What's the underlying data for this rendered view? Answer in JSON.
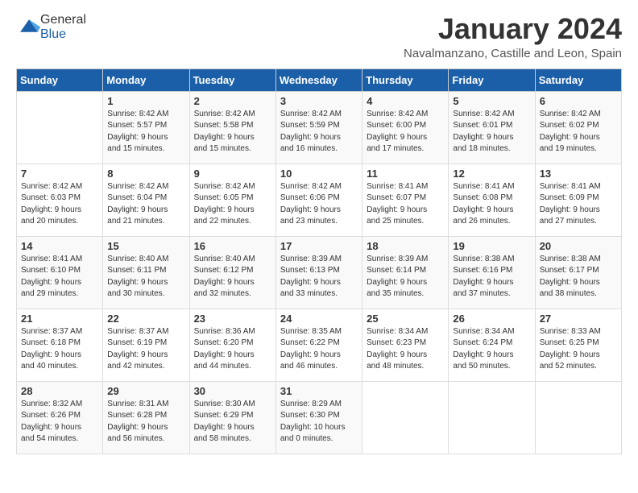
{
  "logo": {
    "general": "General",
    "blue": "Blue"
  },
  "header": {
    "month_year": "January 2024",
    "location": "Navalmanzano, Castille and Leon, Spain"
  },
  "weekdays": [
    "Sunday",
    "Monday",
    "Tuesday",
    "Wednesday",
    "Thursday",
    "Friday",
    "Saturday"
  ],
  "weeks": [
    [
      {
        "day": "",
        "content": ""
      },
      {
        "day": "1",
        "content": "Sunrise: 8:42 AM\nSunset: 5:57 PM\nDaylight: 9 hours\nand 15 minutes."
      },
      {
        "day": "2",
        "content": "Sunrise: 8:42 AM\nSunset: 5:58 PM\nDaylight: 9 hours\nand 15 minutes."
      },
      {
        "day": "3",
        "content": "Sunrise: 8:42 AM\nSunset: 5:59 PM\nDaylight: 9 hours\nand 16 minutes."
      },
      {
        "day": "4",
        "content": "Sunrise: 8:42 AM\nSunset: 6:00 PM\nDaylight: 9 hours\nand 17 minutes."
      },
      {
        "day": "5",
        "content": "Sunrise: 8:42 AM\nSunset: 6:01 PM\nDaylight: 9 hours\nand 18 minutes."
      },
      {
        "day": "6",
        "content": "Sunrise: 8:42 AM\nSunset: 6:02 PM\nDaylight: 9 hours\nand 19 minutes."
      }
    ],
    [
      {
        "day": "7",
        "content": "Sunrise: 8:42 AM\nSunset: 6:03 PM\nDaylight: 9 hours\nand 20 minutes."
      },
      {
        "day": "8",
        "content": "Sunrise: 8:42 AM\nSunset: 6:04 PM\nDaylight: 9 hours\nand 21 minutes."
      },
      {
        "day": "9",
        "content": "Sunrise: 8:42 AM\nSunset: 6:05 PM\nDaylight: 9 hours\nand 22 minutes."
      },
      {
        "day": "10",
        "content": "Sunrise: 8:42 AM\nSunset: 6:06 PM\nDaylight: 9 hours\nand 23 minutes."
      },
      {
        "day": "11",
        "content": "Sunrise: 8:41 AM\nSunset: 6:07 PM\nDaylight: 9 hours\nand 25 minutes."
      },
      {
        "day": "12",
        "content": "Sunrise: 8:41 AM\nSunset: 6:08 PM\nDaylight: 9 hours\nand 26 minutes."
      },
      {
        "day": "13",
        "content": "Sunrise: 8:41 AM\nSunset: 6:09 PM\nDaylight: 9 hours\nand 27 minutes."
      }
    ],
    [
      {
        "day": "14",
        "content": "Sunrise: 8:41 AM\nSunset: 6:10 PM\nDaylight: 9 hours\nand 29 minutes."
      },
      {
        "day": "15",
        "content": "Sunrise: 8:40 AM\nSunset: 6:11 PM\nDaylight: 9 hours\nand 30 minutes."
      },
      {
        "day": "16",
        "content": "Sunrise: 8:40 AM\nSunset: 6:12 PM\nDaylight: 9 hours\nand 32 minutes."
      },
      {
        "day": "17",
        "content": "Sunrise: 8:39 AM\nSunset: 6:13 PM\nDaylight: 9 hours\nand 33 minutes."
      },
      {
        "day": "18",
        "content": "Sunrise: 8:39 AM\nSunset: 6:14 PM\nDaylight: 9 hours\nand 35 minutes."
      },
      {
        "day": "19",
        "content": "Sunrise: 8:38 AM\nSunset: 6:16 PM\nDaylight: 9 hours\nand 37 minutes."
      },
      {
        "day": "20",
        "content": "Sunrise: 8:38 AM\nSunset: 6:17 PM\nDaylight: 9 hours\nand 38 minutes."
      }
    ],
    [
      {
        "day": "21",
        "content": "Sunrise: 8:37 AM\nSunset: 6:18 PM\nDaylight: 9 hours\nand 40 minutes."
      },
      {
        "day": "22",
        "content": "Sunrise: 8:37 AM\nSunset: 6:19 PM\nDaylight: 9 hours\nand 42 minutes."
      },
      {
        "day": "23",
        "content": "Sunrise: 8:36 AM\nSunset: 6:20 PM\nDaylight: 9 hours\nand 44 minutes."
      },
      {
        "day": "24",
        "content": "Sunrise: 8:35 AM\nSunset: 6:22 PM\nDaylight: 9 hours\nand 46 minutes."
      },
      {
        "day": "25",
        "content": "Sunrise: 8:34 AM\nSunset: 6:23 PM\nDaylight: 9 hours\nand 48 minutes."
      },
      {
        "day": "26",
        "content": "Sunrise: 8:34 AM\nSunset: 6:24 PM\nDaylight: 9 hours\nand 50 minutes."
      },
      {
        "day": "27",
        "content": "Sunrise: 8:33 AM\nSunset: 6:25 PM\nDaylight: 9 hours\nand 52 minutes."
      }
    ],
    [
      {
        "day": "28",
        "content": "Sunrise: 8:32 AM\nSunset: 6:26 PM\nDaylight: 9 hours\nand 54 minutes."
      },
      {
        "day": "29",
        "content": "Sunrise: 8:31 AM\nSunset: 6:28 PM\nDaylight: 9 hours\nand 56 minutes."
      },
      {
        "day": "30",
        "content": "Sunrise: 8:30 AM\nSunset: 6:29 PM\nDaylight: 9 hours\nand 58 minutes."
      },
      {
        "day": "31",
        "content": "Sunrise: 8:29 AM\nSunset: 6:30 PM\nDaylight: 10 hours\nand 0 minutes."
      },
      {
        "day": "",
        "content": ""
      },
      {
        "day": "",
        "content": ""
      },
      {
        "day": "",
        "content": ""
      }
    ]
  ]
}
